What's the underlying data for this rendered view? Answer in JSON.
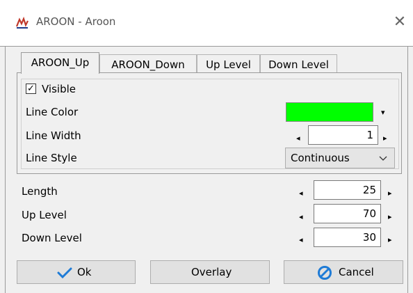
{
  "window": {
    "title": "AROON - Aroon",
    "app_icon": "chart-app-icon",
    "close_icon": "close-icon"
  },
  "tabs": [
    {
      "label": "AROON_Up",
      "active": true
    },
    {
      "label": "AROON_Down",
      "active": false
    },
    {
      "label": "Up Level",
      "active": false
    },
    {
      "label": "Down Level",
      "active": false
    }
  ],
  "tab_panel": {
    "visible_label": "Visible",
    "visible_checked": true,
    "line_color_label": "Line Color",
    "line_color_value": "#00ff00",
    "line_width_label": "Line Width",
    "line_width_value": "1",
    "line_style_label": "Line Style",
    "line_style_value": "Continuous"
  },
  "params": {
    "length_label": "Length",
    "length_value": "25",
    "up_level_label": "Up Level",
    "up_level_value": "70",
    "down_level_label": "Down Level",
    "down_level_value": "30"
  },
  "buttons": {
    "ok_label": "Ok",
    "overlay_label": "Overlay",
    "cancel_label": "Cancel"
  },
  "colors": {
    "accent_blue": "#1e7bd6",
    "line_color": "#00ff00"
  }
}
